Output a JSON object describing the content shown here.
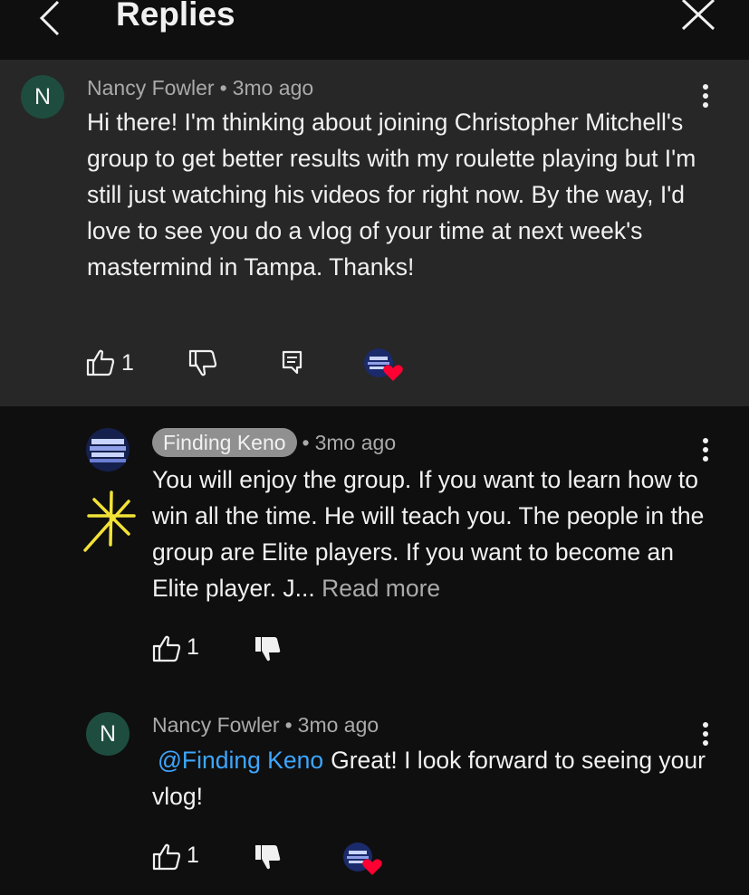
{
  "header": {
    "title": "Replies",
    "back_icon": "chevron-left-icon",
    "close_icon": "close-icon"
  },
  "comments": [
    {
      "avatar_letter": "N",
      "author": "Nancy Fowler",
      "separator": "•",
      "time": "3mo ago",
      "text": "Hi there! I'm thinking about joining Christopher Mitchell's group to get better results with my roulette playing but I'm still just watching his videos for right now. By the way, I'd love to see you do a vlog of your time at next week's mastermind in Tampa. Thanks!",
      "likes": "1",
      "hearted": true
    },
    {
      "avatar_letter": "",
      "author": "Finding Keno",
      "separator": "•",
      "time": "3mo ago",
      "text": "You will enjoy the group. If you want to learn how to win all the time. He will teach you. The people in the group are Elite players. If you want to become an Elite player. J...",
      "read_more": "Read more",
      "likes": "1",
      "hearted": false
    },
    {
      "avatar_letter": "N",
      "author": "Nancy Fowler",
      "separator": "•",
      "time": "3mo ago",
      "mention": "@Finding Keno",
      "text": "Great! I look forward to seeing your vlog!",
      "likes": "1",
      "hearted": true
    }
  ],
  "colors": {
    "background": "#0f0f0f",
    "highlight_background": "#272727",
    "avatar": "#1e4d3f",
    "mention": "#3ea6ff",
    "heart": "#ff0033"
  }
}
